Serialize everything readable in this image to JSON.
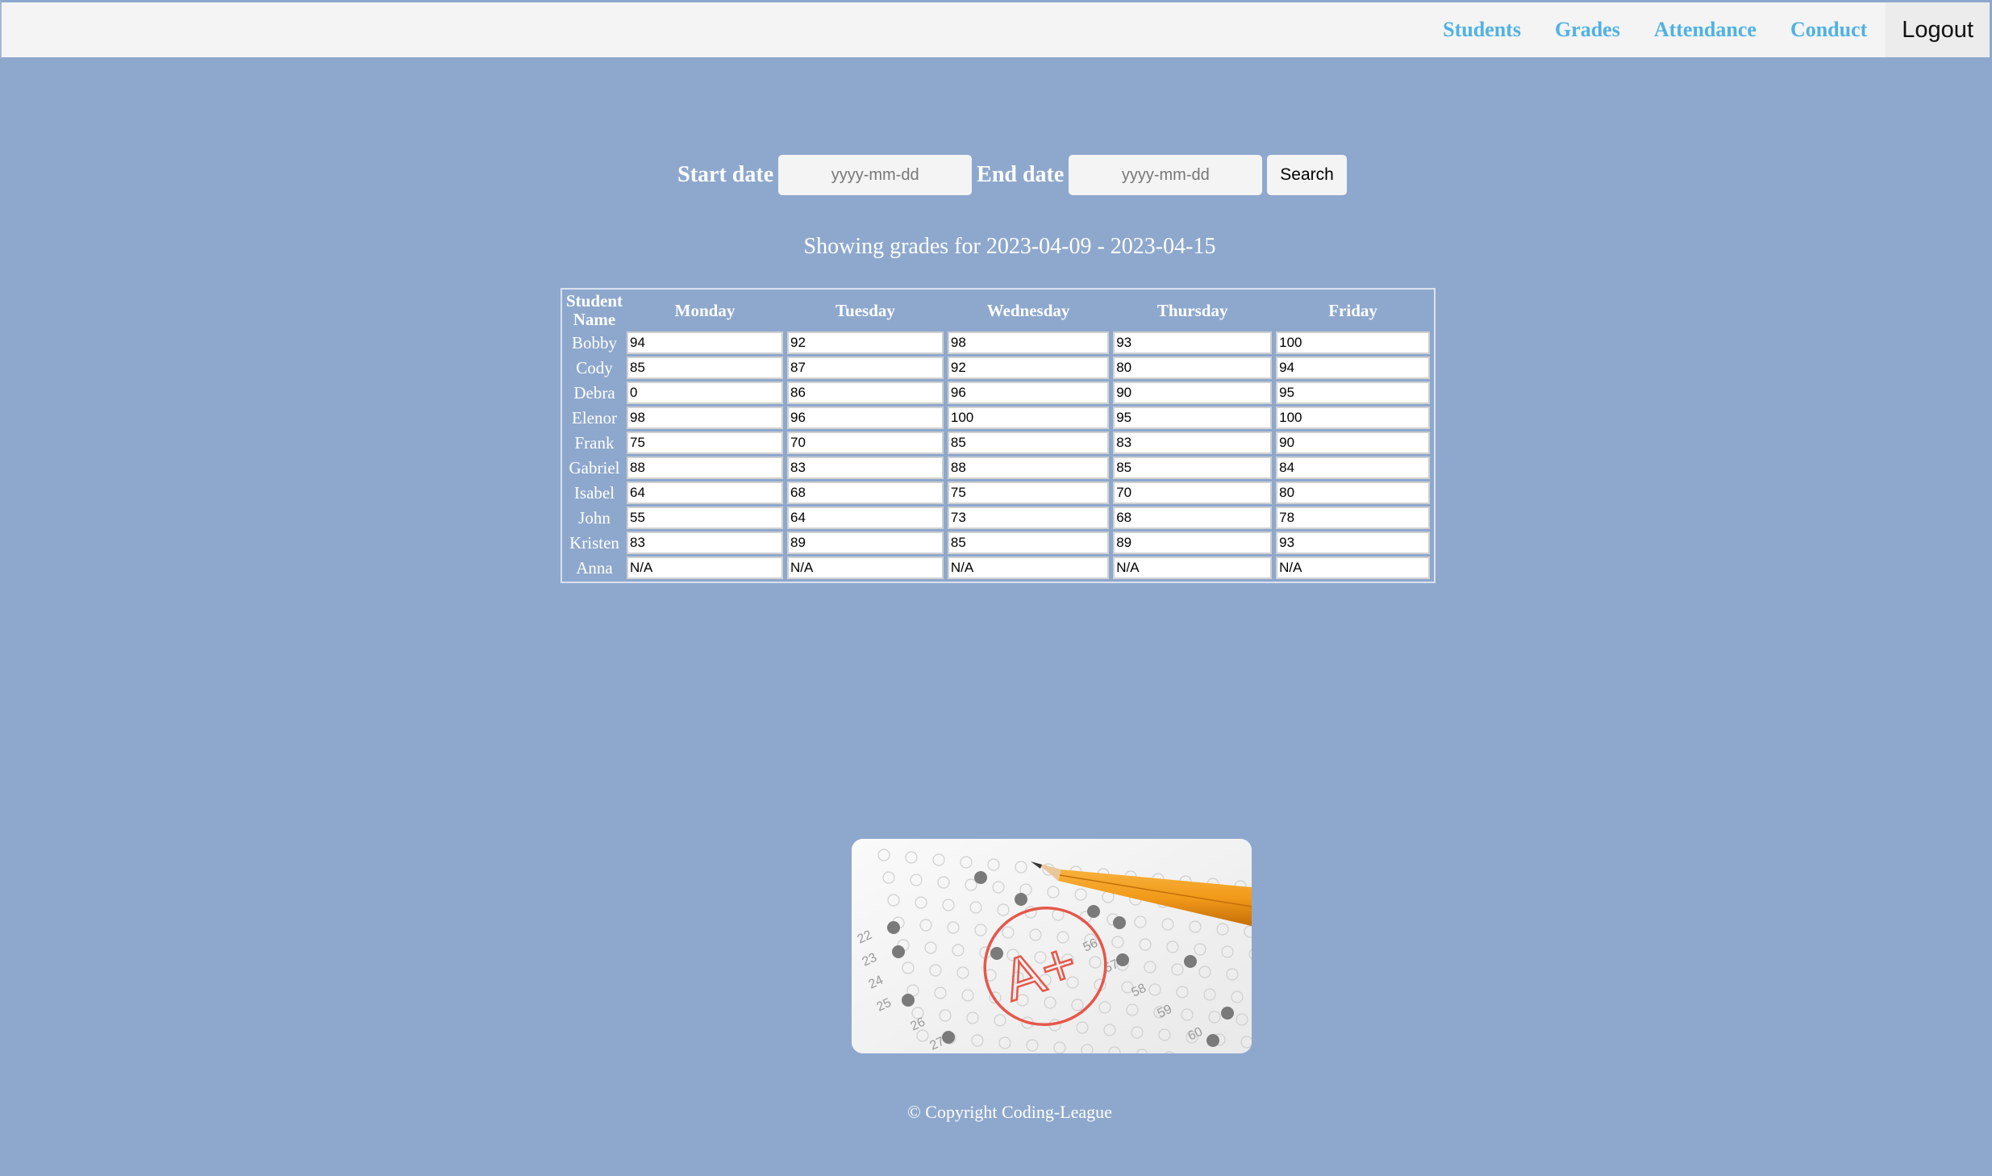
{
  "nav": {
    "links": [
      "Students",
      "Grades",
      "Attendance",
      "Conduct"
    ],
    "logout": "Logout"
  },
  "search": {
    "start_label": "Start date",
    "start_placeholder": "yyyy-mm-dd",
    "end_label": "End date",
    "end_placeholder": "yyyy-mm-dd",
    "button": "Search"
  },
  "showing_text": "Showing grades for 2023-04-09 - 2023-04-15",
  "table": {
    "headers": [
      "Student Name",
      "Monday",
      "Tuesday",
      "Wednesday",
      "Thursday",
      "Friday"
    ],
    "rows": [
      {
        "name": "Bobby",
        "grades": [
          "94",
          "92",
          "98",
          "93",
          "100"
        ]
      },
      {
        "name": "Cody",
        "grades": [
          "85",
          "87",
          "92",
          "80",
          "94"
        ]
      },
      {
        "name": "Debra",
        "grades": [
          "0",
          "86",
          "96",
          "90",
          "95"
        ]
      },
      {
        "name": "Elenor",
        "grades": [
          "98",
          "96",
          "100",
          "95",
          "100"
        ]
      },
      {
        "name": "Frank",
        "grades": [
          "75",
          "70",
          "85",
          "83",
          "90"
        ]
      },
      {
        "name": "Gabriel",
        "grades": [
          "88",
          "83",
          "88",
          "85",
          "84"
        ]
      },
      {
        "name": "Isabel",
        "grades": [
          "64",
          "68",
          "75",
          "70",
          "80"
        ]
      },
      {
        "name": "John",
        "grades": [
          "55",
          "64",
          "73",
          "68",
          "78"
        ]
      },
      {
        "name": "Kristen",
        "grades": [
          "83",
          "89",
          "85",
          "89",
          "93"
        ]
      },
      {
        "name": "Anna",
        "grades": [
          "N/A",
          "N/A",
          "N/A",
          "N/A",
          "N/A"
        ]
      }
    ]
  },
  "image": {
    "grade_mark": "A+",
    "bubble_numbers": [
      "22",
      "23",
      "24",
      "25",
      "26",
      "27",
      "56",
      "57",
      "58",
      "59",
      "60"
    ]
  },
  "footer": "© Copyright Coding-League",
  "colors": {
    "background": "#8ea8cd",
    "nav_link": "#4fb2e4",
    "topbar": "#f4f4f4"
  }
}
